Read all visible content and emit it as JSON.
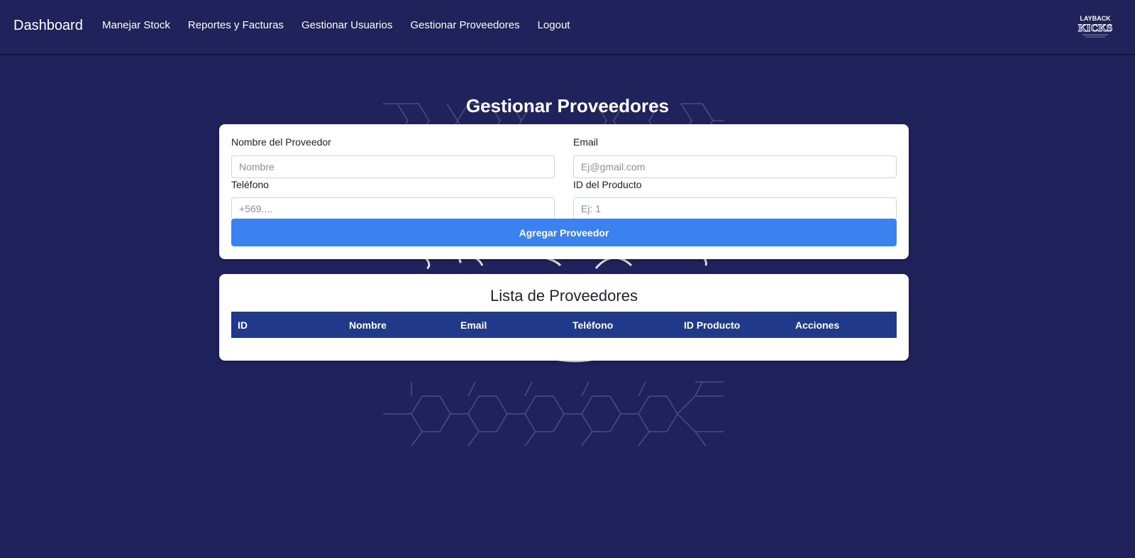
{
  "nav": {
    "brand": "Dashboard",
    "links": [
      "Manejar Stock",
      "Reportes y Facturas",
      "Gestionar Usuarios",
      "Gestionar Proveedores",
      "Logout"
    ],
    "logo_text": "LAYBACK KICKS"
  },
  "page": {
    "title": "Gestionar Proveedores"
  },
  "form": {
    "name_label": "Nombre del Proveedor",
    "name_placeholder": "Nombre",
    "email_label": "Email",
    "email_placeholder": "Ej@gmail.com",
    "phone_label": "Teléfono",
    "phone_placeholder": "+569....",
    "product_label": "ID del Producto",
    "product_placeholder": "Ej: 1",
    "submit_label": "Agregar Proveedor"
  },
  "list": {
    "title": "Lista de Proveedores",
    "columns": [
      "ID",
      "Nombre",
      "Email",
      "Teléfono",
      "ID Producto",
      "Acciones"
    ],
    "rows": []
  },
  "colors": {
    "background": "#20225c",
    "table_header": "#1f3a8a",
    "button": "#3b82f0"
  }
}
